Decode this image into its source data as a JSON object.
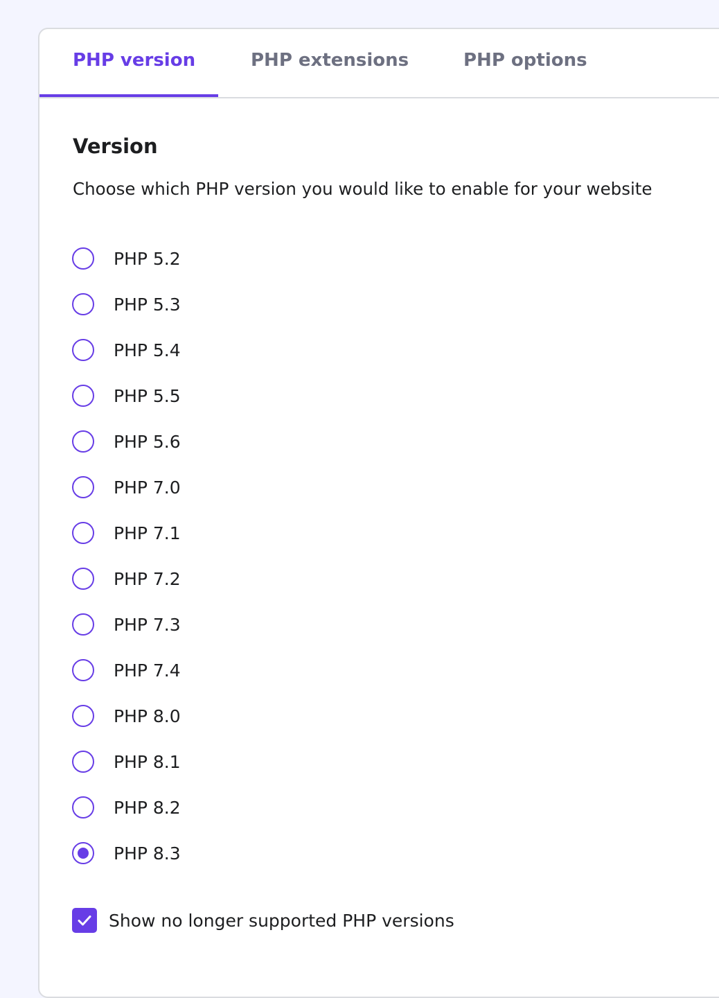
{
  "tabs": [
    {
      "label": "PHP version",
      "active": true
    },
    {
      "label": "PHP extensions",
      "active": false
    },
    {
      "label": "PHP options",
      "active": false
    }
  ],
  "section": {
    "title": "Version",
    "description": "Choose which PHP version you would like to enable for your website"
  },
  "versions": {
    "selected": "PHP 8.3",
    "options": [
      "PHP 5.2",
      "PHP 5.3",
      "PHP 5.4",
      "PHP 5.5",
      "PHP 5.6",
      "PHP 7.0",
      "PHP 7.1",
      "PHP 7.2",
      "PHP 7.3",
      "PHP 7.4",
      "PHP 8.0",
      "PHP 8.1",
      "PHP 8.2",
      "PHP 8.3"
    ]
  },
  "show_unsupported": {
    "label": "Show no longer supported PHP versions",
    "checked": true
  },
  "colors": {
    "accent": "#673de6",
    "text": "#1d1e20",
    "muted_tab": "#6d7081",
    "page_background": "#f4f5ff",
    "border": "#dadce0"
  },
  "icons": {
    "checkbox_mark": "checkmark-icon"
  }
}
